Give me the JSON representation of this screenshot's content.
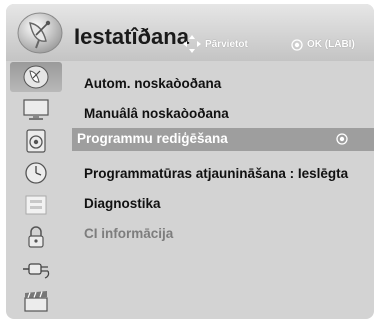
{
  "header": {
    "title": "Iestatîðana",
    "hint_move": "Pārvietot",
    "hint_ok": "OK (LABI)"
  },
  "sidebar": {
    "items": [
      {
        "icon": "satellite-dish-icon",
        "selected": true
      },
      {
        "icon": "tv-screen-icon",
        "selected": false
      },
      {
        "icon": "speaker-icon",
        "selected": false
      },
      {
        "icon": "clock-icon",
        "selected": false
      },
      {
        "icon": "options-icon",
        "selected": false
      },
      {
        "icon": "lock-icon",
        "selected": false
      },
      {
        "icon": "input-plug-icon",
        "selected": false
      },
      {
        "icon": "clapperboard-icon",
        "selected": false
      }
    ]
  },
  "menu": {
    "items": [
      {
        "label": "Autom. noskaòoðana",
        "state": "normal"
      },
      {
        "label": "Manuâlâ noskaòoðana",
        "state": "normal"
      },
      {
        "label": "Programmu rediģēšana",
        "state": "selected"
      },
      {
        "label": "Programmatūras atjaunināšana : Ieslēgta",
        "state": "normal"
      },
      {
        "label": "Diagnostika",
        "state": "normal"
      },
      {
        "label": "CI informācija",
        "state": "disabled"
      }
    ]
  },
  "colors": {
    "panel": "#d3d3d3",
    "selection": "#9e9e9e",
    "disabled_text": "#7d7d7d"
  }
}
